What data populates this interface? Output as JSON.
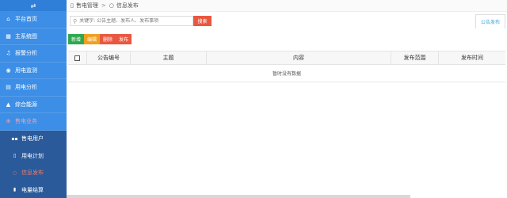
{
  "sidebar": {
    "toggle_icon": "⇄",
    "items": [
      {
        "label": "平台首页",
        "icon": "home-icon"
      },
      {
        "label": "主系统图",
        "icon": "diagram-icon"
      },
      {
        "label": "报警分析",
        "icon": "bell-icon"
      },
      {
        "label": "用电监测",
        "icon": "eye-icon"
      },
      {
        "label": "用电分析",
        "icon": "chart-icon"
      },
      {
        "label": "综合能源",
        "icon": "flask-icon"
      },
      {
        "label": "售电业务",
        "icon": "globe-icon"
      }
    ],
    "sub_items": [
      {
        "label": "售电用户",
        "icon": "grid-icon"
      },
      {
        "label": "用电计划",
        "icon": "doc-icon"
      },
      {
        "label": "信息发布",
        "icon": "circle-icon"
      },
      {
        "label": "电量结算",
        "icon": "doc-icon"
      }
    ]
  },
  "breadcrumb": {
    "parent": "售电管理",
    "separator": ">",
    "current": "信息发布"
  },
  "search": {
    "placeholder": "关键字: 公告主题、发布人、发布事项",
    "button": "搜索"
  },
  "tab": {
    "label": "公告发布"
  },
  "actions": {
    "add": "新增",
    "edit": "编辑",
    "delete": "删除",
    "publish": "发布"
  },
  "table": {
    "columns": [
      "公告编号",
      "主题",
      "内容",
      "发布范围",
      "发布时间"
    ],
    "empty_text": "暂时没有数据"
  },
  "colors": {
    "sidebar": "#3d8ee6",
    "submenu": "#2a5a9a",
    "accent_red": "#e9573f",
    "green": "#2fa84f",
    "orange": "#f0a020",
    "tab_blue": "#3aa7d8"
  }
}
